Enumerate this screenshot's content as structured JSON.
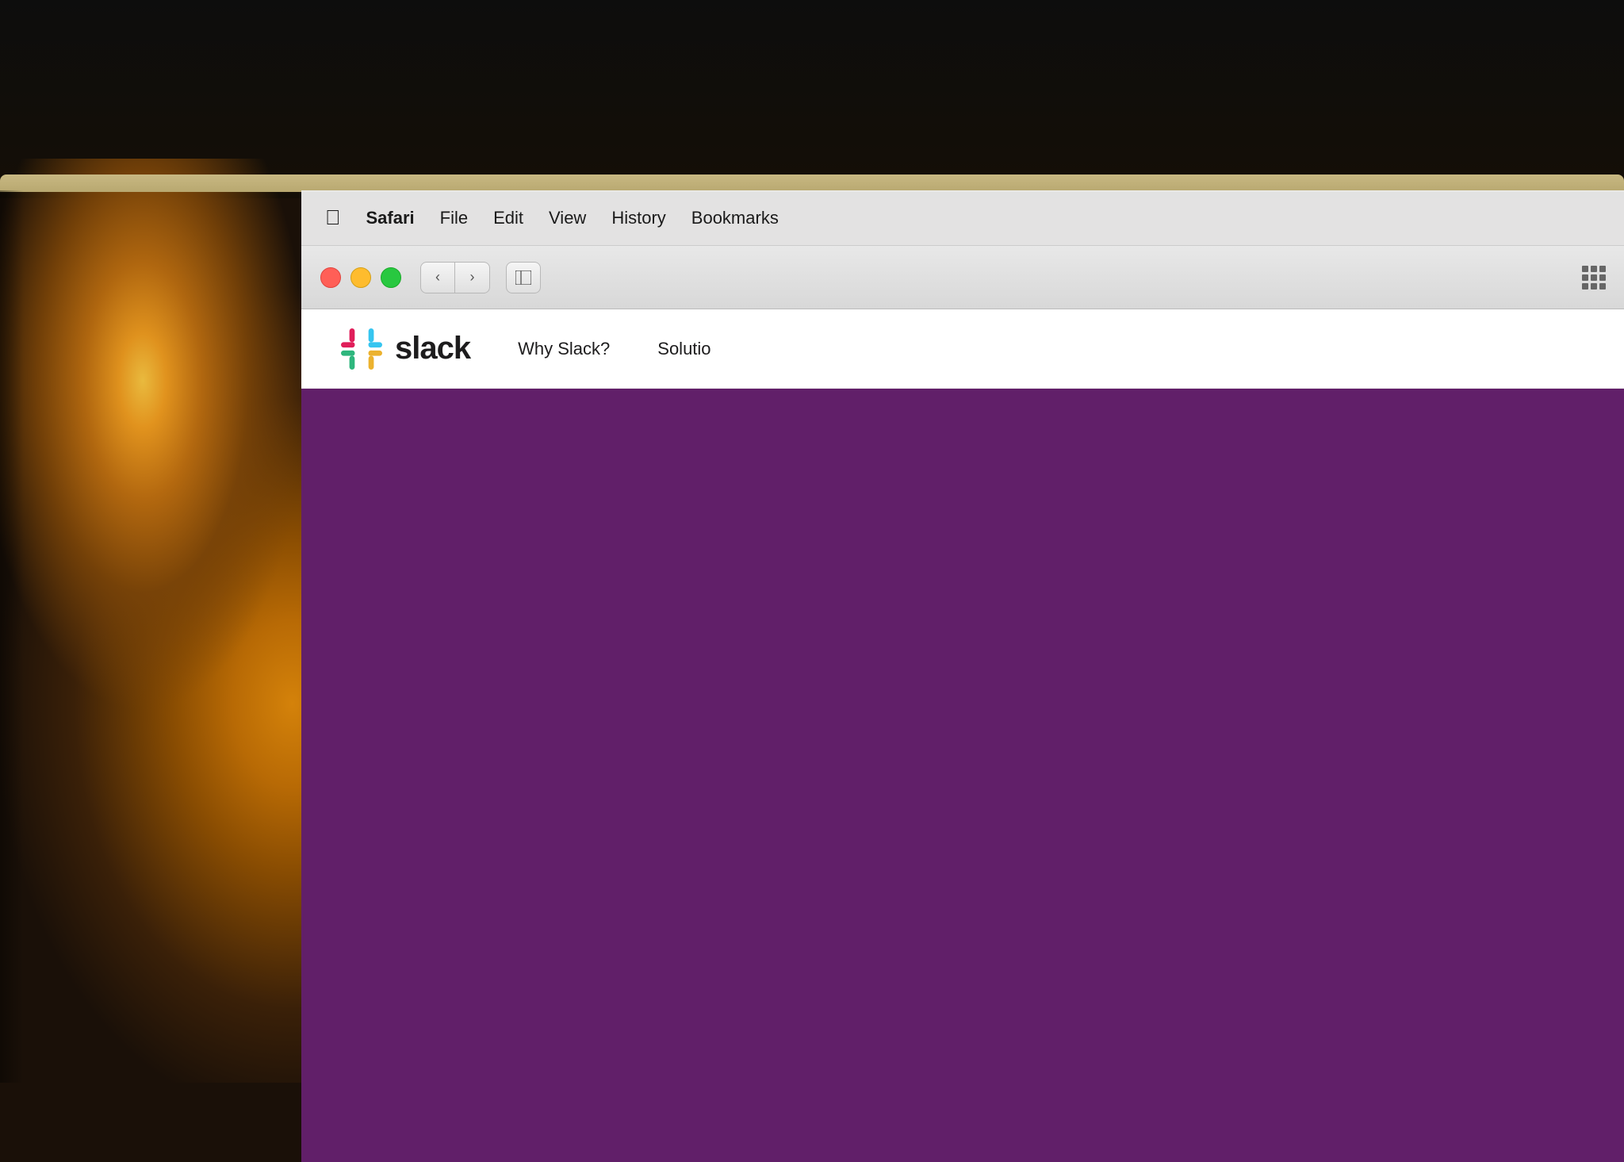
{
  "background": {
    "description": "Dark background with warm bokeh light bulb on left"
  },
  "menubar": {
    "apple_icon": "🍎",
    "items": [
      {
        "label": "Safari",
        "active": true
      },
      {
        "label": "File",
        "active": false
      },
      {
        "label": "Edit",
        "active": false
      },
      {
        "label": "View",
        "active": false
      },
      {
        "label": "History",
        "active": false
      },
      {
        "label": "Bookmarks",
        "active": false
      }
    ]
  },
  "toolbar": {
    "back_icon": "‹",
    "forward_icon": "›"
  },
  "slack_website": {
    "logo_text": "slack",
    "nav_items": [
      {
        "label": "Why Slack?"
      },
      {
        "label": "Solutio"
      }
    ],
    "hero_color": "#611f69"
  }
}
